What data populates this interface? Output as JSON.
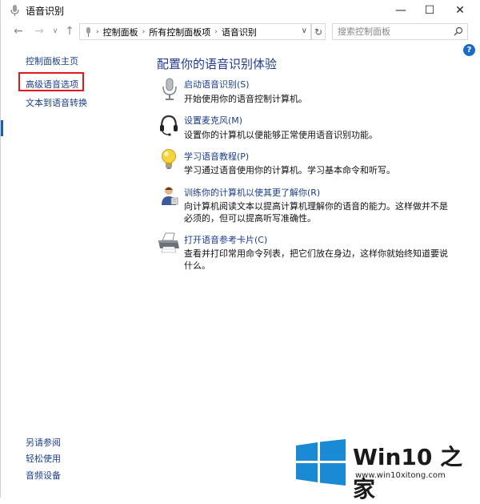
{
  "window": {
    "title": "语音识别",
    "minimize": "—",
    "maximize": "☐",
    "close": "✕"
  },
  "address": {
    "crumbs": [
      "控制面板",
      "所有控制面板项",
      "语音识别"
    ],
    "search_placeholder": "搜索控制面板"
  },
  "help_label": "?",
  "leftnav": {
    "home": "控制面板主页",
    "advanced": "高级语音选项",
    "tts": "文本到语音转换",
    "see_also": "另请参阅",
    "ease": "轻松使用",
    "audio": "音频设备"
  },
  "main": {
    "heading": "配置你的语音识别体验",
    "items": [
      {
        "link": "启动语音识别(S)",
        "desc": "开始使用你的语音控制计算机。",
        "icon": "microphone-icon"
      },
      {
        "link": "设置麦克风(M)",
        "desc": "设置你的计算机以便能够正常使用语音识别功能。",
        "icon": "headset-icon"
      },
      {
        "link": "学习语音教程(P)",
        "desc": "学习通过语音使用你的计算机。学习基本命令和听写。",
        "icon": "lightbulb-icon"
      },
      {
        "link": "训练你的计算机以使其更了解你(R)",
        "desc": "向计算机阅读文本以提高计算机理解你的语音的能力。这样做并不是必须的，但可以提高听写准确性。",
        "icon": "user-training-icon"
      },
      {
        "link": "打开语音参考卡片(C)",
        "desc": "查看并打印常用命令列表，把它们放在身边，这样你就始终知道要说什么。",
        "icon": "printer-icon"
      }
    ]
  },
  "watermark": {
    "brand": "Win10 之家",
    "url": "www.win10xitong.com"
  },
  "colors": {
    "link": "#1a3e8b",
    "heading": "#1e3b8c",
    "highlight": "#e0191f",
    "win_blue": "#1a8ad4"
  }
}
